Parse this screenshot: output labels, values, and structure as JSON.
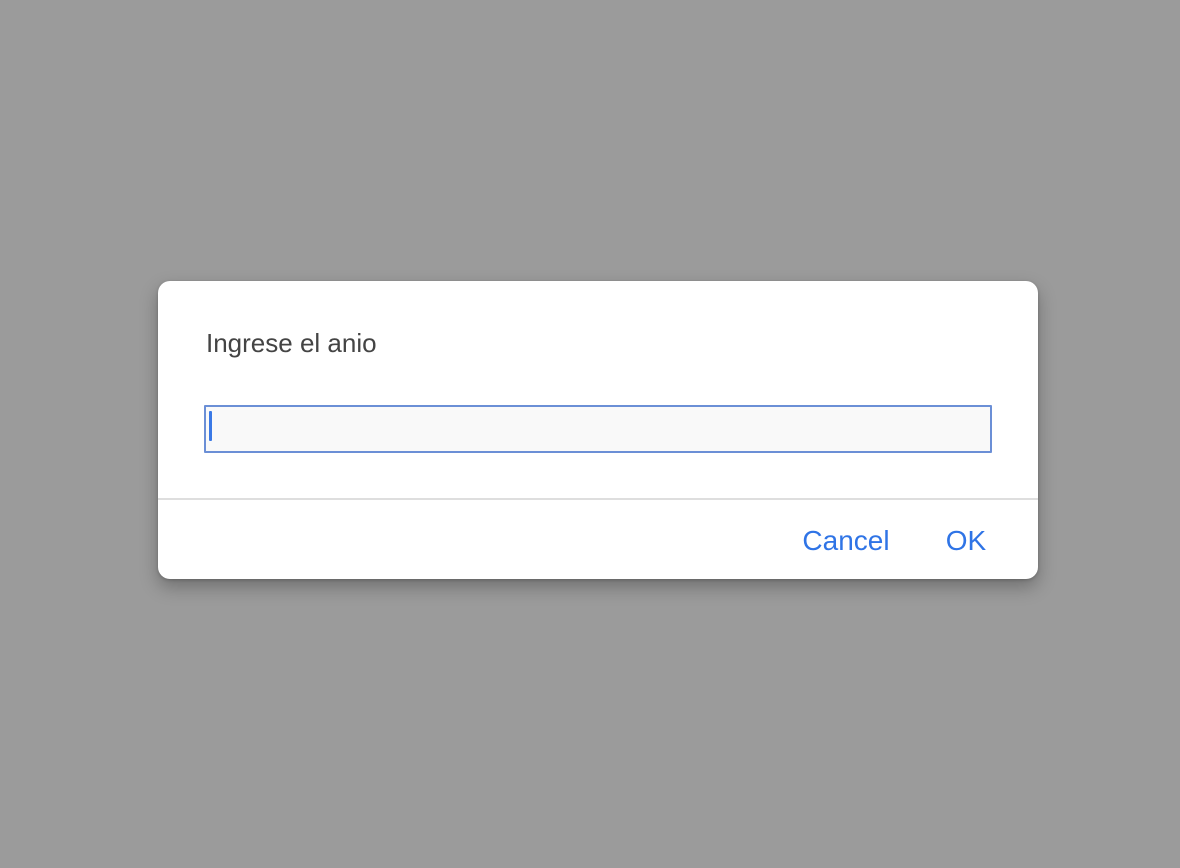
{
  "colors": {
    "backdrop": "#9b9b9b",
    "accent": "#2f74e6"
  },
  "dialog": {
    "message": "Ingrese el anio",
    "input": {
      "value": "",
      "placeholder": ""
    },
    "buttons": {
      "cancel_label": "Cancel",
      "ok_label": "OK"
    }
  }
}
